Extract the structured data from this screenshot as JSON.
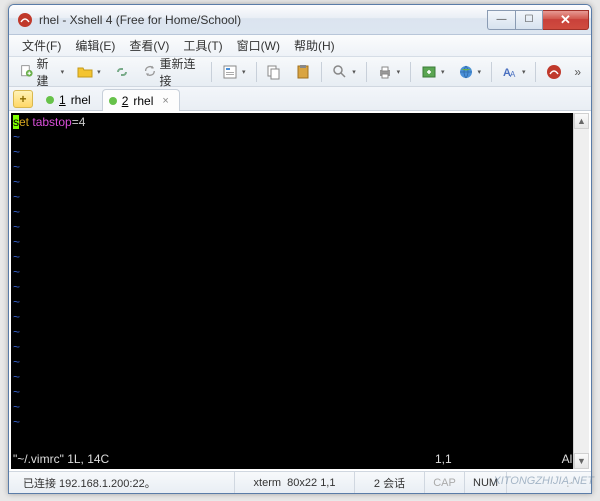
{
  "titlebar": {
    "title": "rhel - Xshell 4 (Free for Home/School)"
  },
  "menu": {
    "items": [
      "文件(F)",
      "编辑(E)",
      "查看(V)",
      "工具(T)",
      "窗口(W)",
      "帮助(H)"
    ]
  },
  "toolbar": {
    "new_label": "新建",
    "reconnect_label": "重新连接"
  },
  "tabs": {
    "items": [
      {
        "num": "1",
        "label": "rhel",
        "active": false
      },
      {
        "num": "2",
        "label": "rhel",
        "active": true
      }
    ]
  },
  "terminal": {
    "cursor_char": "s",
    "cmd": "et",
    "option": "tabstop",
    "eq": "=4",
    "tilde": "~",
    "vim_file": "\"~/.vimrc\" 1L, 14C",
    "vim_pos": "1,1",
    "vim_pct": "All"
  },
  "status": {
    "connection": "已连接 192.168.1.200:22。",
    "term": "xterm",
    "size": "80x22",
    "cursor": "1,1",
    "sessions": "2 会话",
    "cap": "CAP",
    "num": "NUM"
  },
  "watermark": "XITONGZHIJIA.NET"
}
